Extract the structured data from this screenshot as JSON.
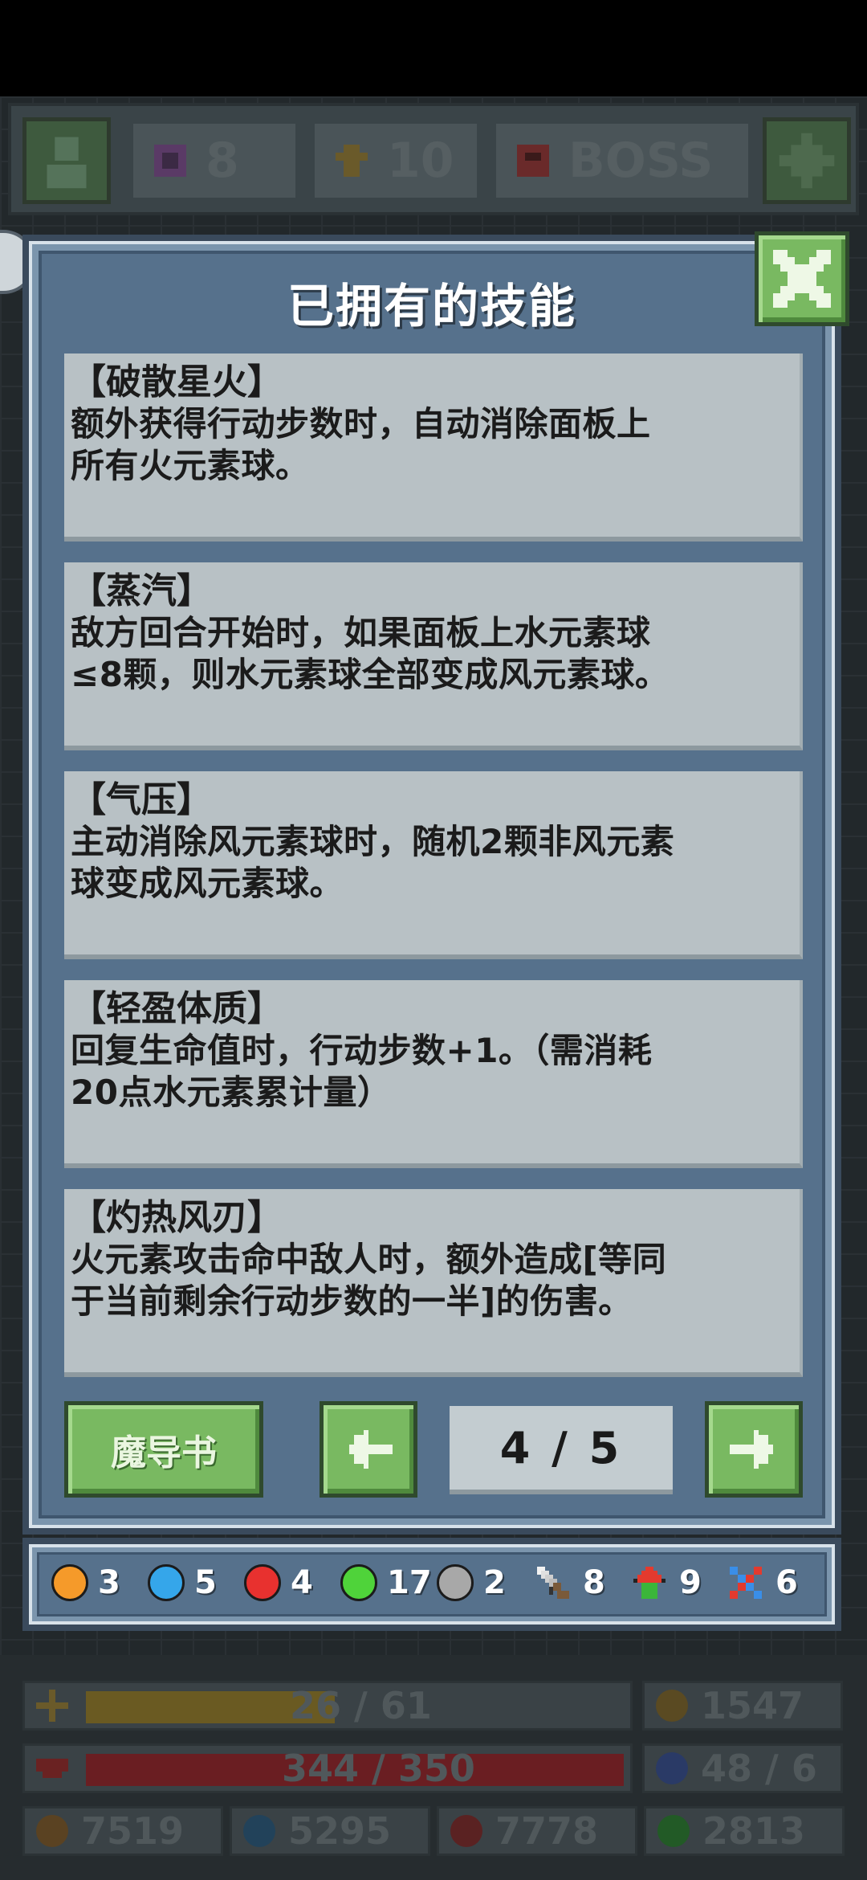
{
  "topbar": {
    "gem_count": "8",
    "level": "10",
    "boss_label": "BOSS"
  },
  "modal": {
    "title": "已拥有的技能",
    "skills": [
      {
        "name": "【破散星火】",
        "desc_line1": "额外获得行动步数时，自动消除面板上",
        "desc_line2": "所有火元素球。"
      },
      {
        "name": "【蒸汽】",
        "desc_line1": "敌方回合开始时，如果面板上水元素球",
        "desc_line2": "≤8颗，则水元素球全部变成风元素球。"
      },
      {
        "name": "【气压】",
        "desc_line1": "主动消除风元素球时，随机2颗非风元素",
        "desc_line2": "球变成风元素球。"
      },
      {
        "name": "【轻盈体质】",
        "desc_line1": "回复生命值时，行动步数+1。（需消耗",
        "desc_line2": "20点水元素累计量）"
      },
      {
        "name": "【灼热风刃】",
        "desc_line1": "火元素攻击命中敌人时，额外造成[等同",
        "desc_line2": "于当前剩余行动步数的一半]的伤害。"
      }
    ],
    "grimoire_button": "魔导书",
    "page_indicator": "4 / 5",
    "prev_icon": "arrow-left-icon",
    "next_icon": "arrow-right-icon",
    "close_icon": "close-icon"
  },
  "resources": [
    {
      "icon": "orange-orb-icon",
      "color": "#f59a2a",
      "count": "3"
    },
    {
      "icon": "blue-orb-icon",
      "color": "#35a6ea",
      "count": "5"
    },
    {
      "icon": "red-orb-icon",
      "color": "#e8312f",
      "count": "4"
    },
    {
      "icon": "green-orb-icon",
      "color": "#4fd33a",
      "count": "17"
    },
    {
      "icon": "gray-orb-icon",
      "color": "#a8a8a8",
      "count": "2"
    },
    {
      "icon": "sword-icon",
      "color": "#e6e6e6",
      "count": "8"
    },
    {
      "icon": "heal-arrow-icon",
      "color": "#e33a2e",
      "count": "9"
    },
    {
      "icon": "crossed-weapons-icon",
      "color": "#3a8ee8",
      "count": "6"
    }
  ],
  "bottom_stats": {
    "exp": "26 / 61",
    "gold": "1547",
    "hp": "344 / 350",
    "stat_extra": "48 / 6",
    "res1": "7519",
    "res2": "5295",
    "res3": "7778",
    "res4": "2813"
  }
}
